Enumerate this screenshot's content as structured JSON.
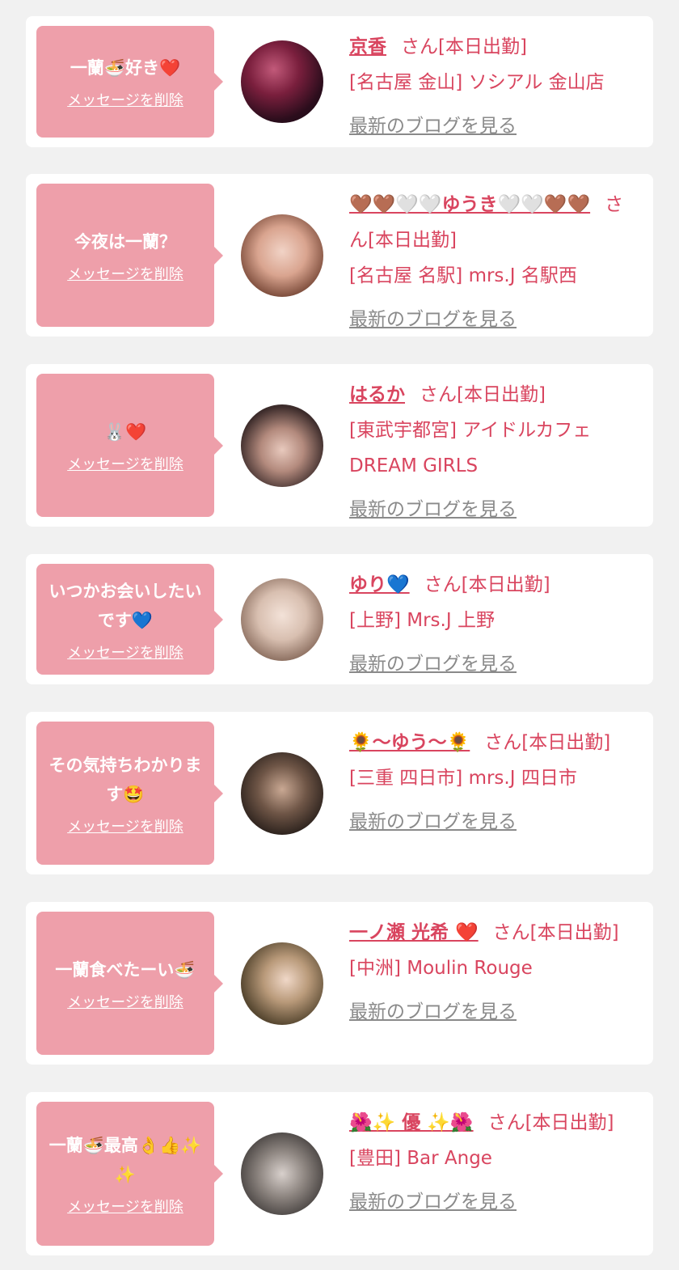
{
  "delete_label": "メッセージを削除",
  "blog_label": "最新のブログを見る",
  "accent_color": "#ee9faa",
  "name_color": "#d9455f",
  "cards": [
    {
      "message": "一蘭🍜好き❤️",
      "name": "京香",
      "suffix": "さん[本日出勤]",
      "shop": "[名古屋 金山] ソシアル 金山店"
    },
    {
      "message": "今夜は一蘭？",
      "name": "🤎🤎🤍🤍ゆうき🤍🤍🤎🤎",
      "suffix": "さん[本日出勤]",
      "shop": "[名古屋 名駅] mrs.J 名駅西"
    },
    {
      "message": "🐰❤️",
      "name": "はるか",
      "suffix": "さん[本日出勤]",
      "shop": "[東武宇都宮] アイドルカフェ DREAM GIRLS"
    },
    {
      "message": "いつかお会いしたいです💙",
      "name": "ゆり💙",
      "suffix": "さん[本日出勤]",
      "shop": "[上野] Mrs.J 上野"
    },
    {
      "message": "その気持ちわかります🤩",
      "name": "🌻〜ゆう〜🌻",
      "suffix": "さん[本日出勤]",
      "shop": "[三重 四日市] mrs.J 四日市"
    },
    {
      "message": "一蘭食べたーい🍜",
      "name": "一ノ瀬 光希 ❤️",
      "suffix": "さん[本日出勤]",
      "shop": "[中洲] Moulin Rouge"
    },
    {
      "message": "一蘭🍜最高👌👍✨✨",
      "name": "🌺✨ 優 ✨🌺",
      "suffix": "さん[本日出勤]",
      "shop": "[豊田] Bar Ange"
    }
  ]
}
